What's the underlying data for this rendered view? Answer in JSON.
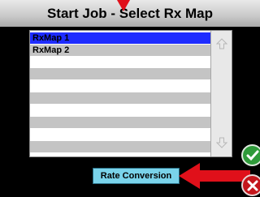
{
  "header": {
    "title": "Start Job - Select Rx Map"
  },
  "rx_list": {
    "items": [
      "RxMap 1",
      "RxMap 2",
      "",
      "",
      "",
      "",
      "",
      "",
      "",
      "",
      ""
    ],
    "selected_index": 0,
    "scroll_up_icon": "arrow-up-icon",
    "scroll_down_icon": "arrow-down-icon"
  },
  "actions": {
    "rate_conversion_label": "Rate Conversion",
    "ok_icon": "checkmark-icon",
    "cancel_icon": "close-icon"
  },
  "colors": {
    "selected_row": "#1e2cff",
    "button": "#7ad3ea",
    "annotation_arrow": "#e0101a",
    "ok": "#2f9a3a",
    "cancel": "#c4161c"
  }
}
